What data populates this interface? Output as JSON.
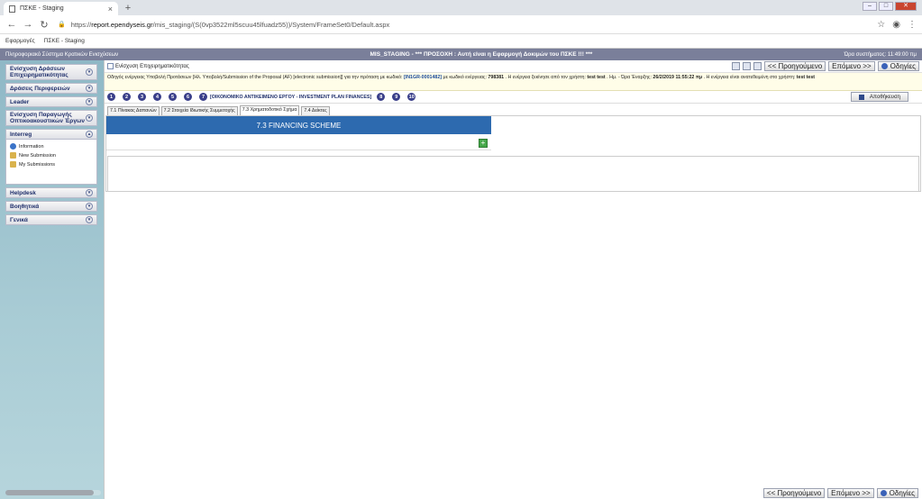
{
  "browser": {
    "tab_title": "ΠΣΚΕ - Staging",
    "url_scheme": "https://",
    "url_host": "report.ependyseis.gr",
    "url_path": "/mis_staging/(S(0vp3522ml5scuu45lfuadz55))/System/FrameSet0/Default.aspx",
    "bookmarks": [
      "Εφαρμογές",
      "ΠΣΚΕ - Staging"
    ]
  },
  "appbar": {
    "left": "Πληροφοριακό Σύστημα Κρατικών Ενισχύσεων",
    "center": "MIS_STAGING - *** ΠΡΟΣΟΧΗ : Αυτή είναι η Εφαρμογή Δοκιμών του ΠΣΚΕ !!! ***",
    "right": "Ώρα συστήματος: 11:49:00 πμ"
  },
  "sidebar": {
    "items": [
      {
        "label": "Ενίσχυση Δράσεων Επιχειρηματικότητας"
      },
      {
        "label": "Δράσεις Περιφερειών"
      },
      {
        "label": "Leader"
      },
      {
        "label": "Ενίσχυση Παραγωγής Οπτικοακουστικών Έργων"
      },
      {
        "label": "Interreg"
      }
    ],
    "interreg_sub": [
      "Information",
      "New Submission",
      "My Submissions"
    ],
    "items_after": [
      {
        "label": "Helpdesk"
      },
      {
        "label": "Βοηθητικά"
      },
      {
        "label": "Γενικά"
      }
    ]
  },
  "header": {
    "breadcrumb": "Ενίσχυση Επιχειρηματικότητας",
    "prev_label": "<< Προηγούμενο",
    "next_label": "Επόμενο >>",
    "help_label": "Οδηγίες"
  },
  "info": {
    "part1": "Οδηγός ενέργειας Υποβολή Προτάσεων [Ηλ. Υποβολή/Submission of the Proposal (AF) [electronic submission]] για την πρόταση με κωδικό: ",
    "code": "[IN1GR-0001482]",
    "part2": " με κωδικό ενέργειας: ",
    "action_code": "798381",
    "part3": " . Η ενέργεια ξεκίνησε από τον χρήστη: ",
    "user": "test test",
    "part4": " . Ημ. - Ώρα Έναρξης: ",
    "start": "26/2/2019 11:55:22 πμ",
    "part5": " . Η ενέργεια είναι ανατεθειμένη στο χρήστη: ",
    "assigned": "test test"
  },
  "steps": {
    "before": [
      "1",
      "2",
      "3",
      "4",
      "5",
      "6"
    ],
    "active": "7",
    "active_label": "[ΟΙΚΟΝΟΜΙΚΟ ΑΝΤΙΚΕΙΜΕΝΟ ΕΡΓΟΥ - INVESTMENT PLAN FINANCES]",
    "after": [
      "8",
      "9",
      "10"
    ],
    "save_label": "Αποθήκευση"
  },
  "tabs": [
    "7.1 Πίνακας Δαπανών",
    "7.2 Στοιχεία Ιδιωτικής Συμμετοχής",
    "7.3 Χρηματοδοτικό Σχήμα",
    "7.4 Δείκτες"
  ],
  "panel": {
    "heading": "7.3 FINANCING SCHEME",
    "add_symbol": "+"
  },
  "colors": {
    "accent": "#2d6aaf",
    "appbar": "#7a7f9a",
    "sidebar": "#a9ccd5",
    "step": "#3a3f8a"
  }
}
